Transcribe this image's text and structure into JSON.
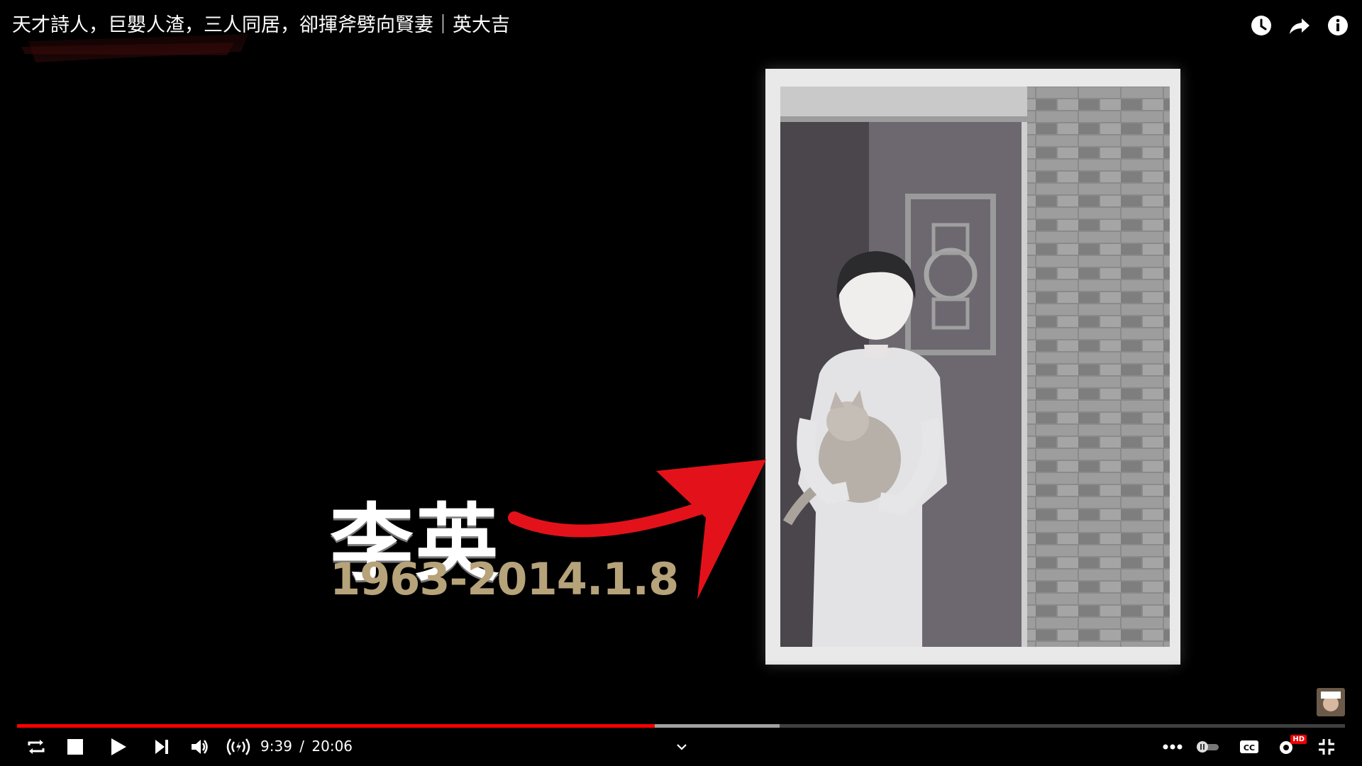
{
  "video": {
    "title": "天才詩人，巨嬰人渣，三人同居，卻揮斧劈向賢妻｜英大吉",
    "watermark_logo": "英大吉"
  },
  "overlay": {
    "name": "李英",
    "dates": "1963-2014.1.8"
  },
  "top_actions": [
    {
      "name": "watch-later-icon"
    },
    {
      "name": "share-icon"
    },
    {
      "name": "info-icon"
    }
  ],
  "player": {
    "current_time": "9:39",
    "duration": "20:06",
    "separator": "/",
    "played_fraction": 0.48,
    "buffered_fraction": 0.574
  },
  "icons": [
    "loop-icon",
    "stop-icon",
    "play-icon",
    "next-icon",
    "volume-icon",
    "live-signal-icon",
    "chevron-down-icon",
    "more-icon",
    "autoplay-toggle-icon",
    "captions-icon",
    "settings-icon",
    "exit-fullscreen-icon"
  ],
  "settings": {
    "quality_badge": "HD"
  },
  "colors": {
    "played": "#ff0000",
    "date_text": "#b6a37a",
    "arrow": "#e3121a"
  }
}
